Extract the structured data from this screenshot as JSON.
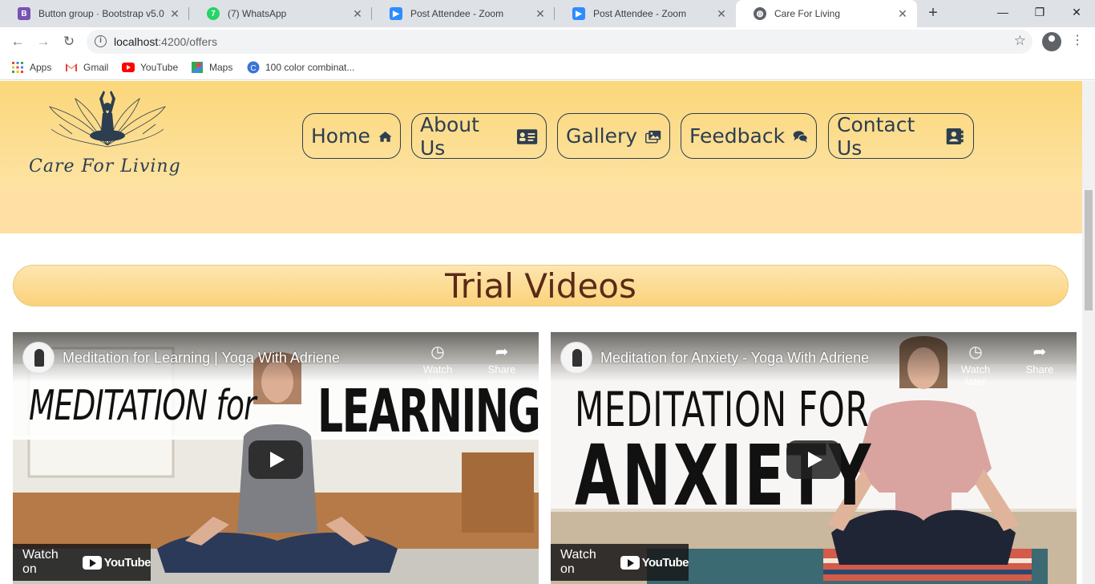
{
  "browser": {
    "tabs": [
      {
        "title": "Button group · Bootstrap v5.0",
        "favicon": "bootstrap-icon",
        "color": "#7952b3",
        "active": false
      },
      {
        "title": "(7) WhatsApp",
        "favicon": "whatsapp-icon",
        "color": "#25d366",
        "active": false
      },
      {
        "title": "Post Attendee - Zoom",
        "favicon": "zoom-icon",
        "color": "#2d8cff",
        "active": false
      },
      {
        "title": "Post Attendee - Zoom",
        "favicon": "zoom-icon",
        "color": "#2d8cff",
        "active": false
      },
      {
        "title": "Care For Living",
        "favicon": "globe-icon",
        "color": "#5f6368",
        "active": true
      }
    ],
    "url_host": "localhost",
    "url_path": ":4200/offers",
    "bookmarks": [
      {
        "label": "Apps",
        "icon": "apps-grid-icon"
      },
      {
        "label": "Gmail",
        "icon": "gmail-icon"
      },
      {
        "label": "YouTube",
        "icon": "youtube-icon"
      },
      {
        "label": "Maps",
        "icon": "maps-icon"
      },
      {
        "label": "100 color combinat...",
        "icon": "canva-icon"
      }
    ]
  },
  "site": {
    "brand": "Care For Living",
    "nav": [
      {
        "label": "Home",
        "icon": "home-icon"
      },
      {
        "label": "About Us",
        "icon": "id-card-icon"
      },
      {
        "label": "Gallery",
        "icon": "images-icon"
      },
      {
        "label": "Feedback",
        "icon": "comments-icon"
      },
      {
        "label": "Contact Us",
        "icon": "address-book-icon"
      }
    ],
    "section_title": "Trial Videos",
    "videos": [
      {
        "title": "Meditation for Learning | Yoga With Adriene",
        "overlay_line1": "MEDITATION for",
        "overlay_line2": "LEARNING",
        "watch_later": "Watch later",
        "share": "Share",
        "watch_on": "Watch on",
        "platform": "YouTube"
      },
      {
        "title": "Meditation for Anxiety - Yoga With Adriene",
        "overlay_line1": "MEDITATION FOR",
        "overlay_line2": "ANXIETY",
        "watch_later": "Watch later",
        "share": "Share",
        "watch_on": "Watch on",
        "platform": "YouTube"
      }
    ],
    "colors": {
      "header_gradient_top": "#fbd77a",
      "header_gradient_bottom": "#ffdfa4",
      "nav_text": "#2c3e50",
      "section_title": "#5a2a16"
    }
  }
}
